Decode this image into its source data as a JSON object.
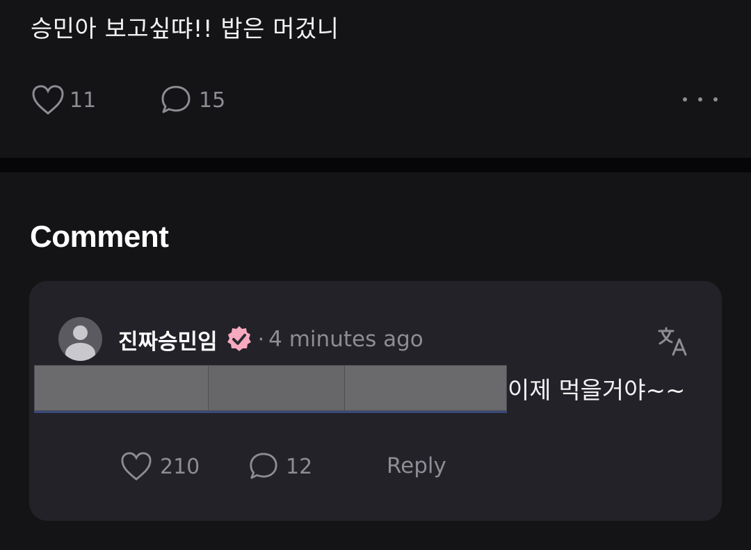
{
  "post": {
    "text": "승민아 보고싶땨!! 밥은 머겄니",
    "likes": "11",
    "comments": "15"
  },
  "section": {
    "title": "Comment"
  },
  "comment": {
    "username": "진짜승민임",
    "separator": "·",
    "timestamp": "4 minutes ago",
    "text": "이제 먹을거야~~",
    "likes": "210",
    "replies": "12",
    "reply_label": "Reply",
    "badge_color": "#f7a9c0"
  },
  "colors": {
    "background": "#141417",
    "card": "#222228",
    "muted": "#8d8d94"
  }
}
